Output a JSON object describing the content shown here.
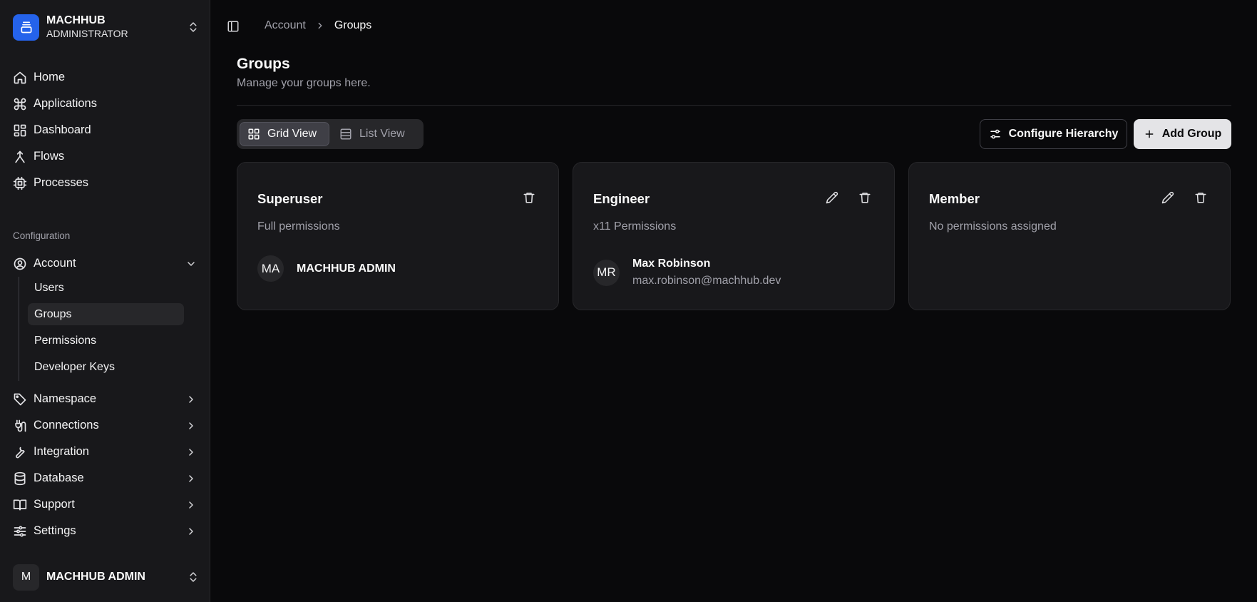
{
  "org": {
    "name": "MACHHUB",
    "role": "ADMINISTRATOR"
  },
  "nav": {
    "main": [
      {
        "label": "Home",
        "icon": "home-icon"
      },
      {
        "label": "Applications",
        "icon": "command-icon"
      },
      {
        "label": "Dashboard",
        "icon": "dashboard-icon"
      },
      {
        "label": "Flows",
        "icon": "flows-icon"
      },
      {
        "label": "Processes",
        "icon": "cpu-icon"
      }
    ],
    "group_label": "Configuration",
    "account": {
      "label": "Account",
      "icon": "user-circle-icon",
      "expanded": true
    },
    "account_sub": [
      "Users",
      "Groups",
      "Permissions",
      "Developer Keys"
    ],
    "active_sub": "Groups",
    "config_items": [
      {
        "label": "Namespace",
        "icon": "tag-icon"
      },
      {
        "label": "Connections",
        "icon": "plug-icon"
      },
      {
        "label": "Integration",
        "icon": "wrench-icon"
      },
      {
        "label": "Database",
        "icon": "database-icon"
      },
      {
        "label": "Support",
        "icon": "book-icon"
      },
      {
        "label": "Settings",
        "icon": "sliders-icon"
      }
    ]
  },
  "user": {
    "initial": "M",
    "name": "MACHHUB ADMIN"
  },
  "breadcrumb": {
    "parent": "Account",
    "current": "Groups"
  },
  "page": {
    "title": "Groups",
    "subtitle": "Manage your groups here."
  },
  "view_toggle": {
    "grid": "Grid View",
    "list": "List View",
    "active": "grid"
  },
  "actions": {
    "configure": "Configure Hierarchy",
    "add": "Add Group"
  },
  "groups": [
    {
      "name": "Superuser",
      "permissions": "Full permissions",
      "editable": false,
      "member": {
        "initials": "MA",
        "name": "MACHHUB ADMIN",
        "email": ""
      }
    },
    {
      "name": "Engineer",
      "permissions": "x11 Permissions",
      "editable": true,
      "member": {
        "initials": "MR",
        "name": "Max Robinson",
        "email": "max.robinson@machhub.dev"
      }
    },
    {
      "name": "Member",
      "permissions": "No permissions assigned",
      "editable": true,
      "member": null
    }
  ],
  "colors": {
    "brand": "#2563eb",
    "background": "#09090b",
    "sidebar": "#18181b",
    "card": "#18181b",
    "muted": "#a1a1aa"
  }
}
